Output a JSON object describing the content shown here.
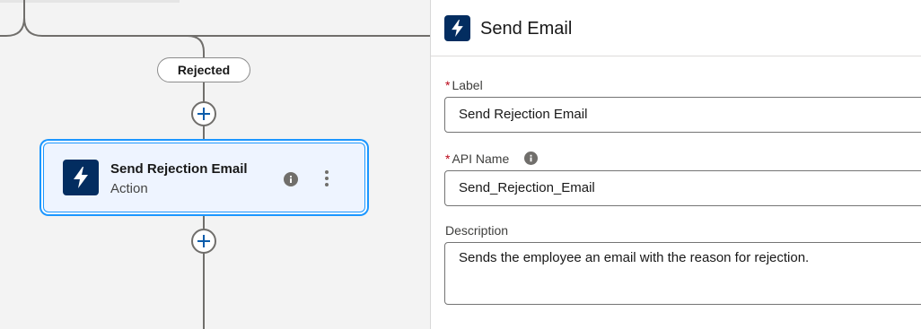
{
  "canvas": {
    "branch_label": "Rejected",
    "node": {
      "title": "Send Rejection Email",
      "subtitle": "Action",
      "icon": "lightning-bolt-icon"
    }
  },
  "panel": {
    "title": "Send Email",
    "icon": "lightning-bolt-icon",
    "fields": {
      "label": {
        "required_mark": "*",
        "label": "Label",
        "value": "Send Rejection Email"
      },
      "api_name": {
        "required_mark": "*",
        "label": "API Name",
        "value": "Send_Rejection_Email"
      },
      "description": {
        "label": "Description",
        "value": "Sends the employee an email with the reason for rejection."
      }
    }
  },
  "colors": {
    "icon_background": "#032d60",
    "selection_accent": "#1b96ff",
    "required_mark": "#ba0517",
    "add_button_plus": "#0b5cab"
  }
}
